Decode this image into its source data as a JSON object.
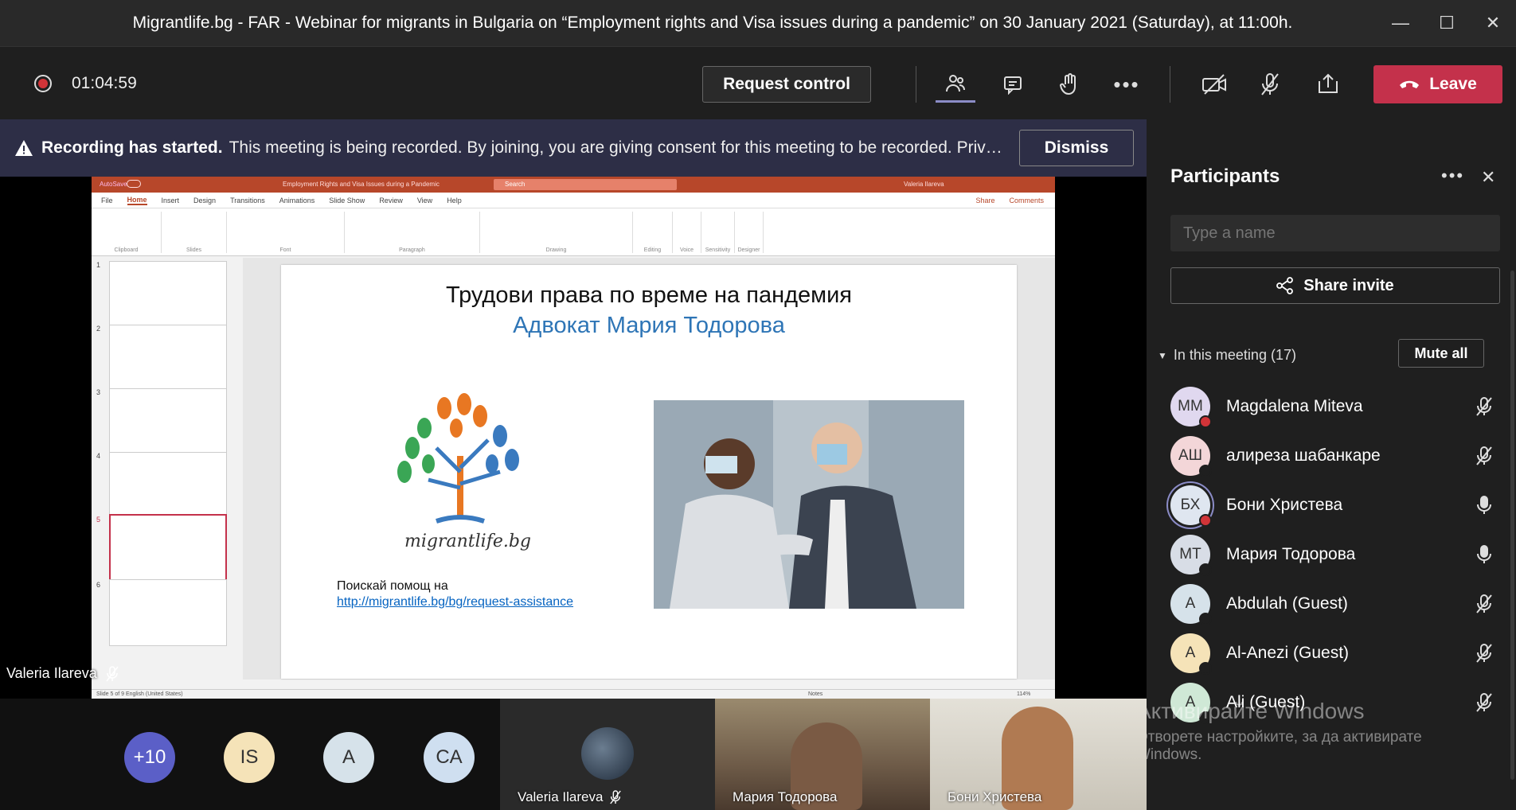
{
  "window": {
    "title": "Migrantlife.bg - FAR - Webinar for migrants in Bulgaria on “Employment rights and Visa issues during a pandemic” on 30 January 2021 (Saturday), at 11:00h."
  },
  "toolbar": {
    "timer": "01:04:59",
    "request_control": "Request control",
    "leave": "Leave",
    "accent": "#c4314b"
  },
  "banner": {
    "bold": "Recording has started.",
    "text": "This meeting is being recorded. By joining, you are giving consent for this meeting to be recorded. Priv…",
    "dismiss": "Dismiss"
  },
  "ppt": {
    "autosave": "AutoSave",
    "doc_title": "Employment Rights and Visa Issues during a Pandemic",
    "search": "Search",
    "user": "Valeria Ilareva",
    "tabs": [
      "File",
      "Home",
      "Insert",
      "Design",
      "Transitions",
      "Animations",
      "Slide Show",
      "Review",
      "View",
      "Help"
    ],
    "share": "Share",
    "comments": "Comments",
    "groups": [
      "Clipboard",
      "Slides",
      "Font",
      "Paragraph",
      "Drawing",
      "Editing",
      "Voice",
      "Sensitivity",
      "Designer"
    ],
    "thumb_numbers": [
      "1",
      "2",
      "3",
      "4",
      "5",
      "6"
    ],
    "status": "Slide 5 of 9     English (United States)",
    "notes": "Notes",
    "zoom": "114%"
  },
  "slide": {
    "title": "Трудови права по време на пандемия",
    "subtitle": "Адвокат Мария Тодорова",
    "logo": "migrantlife.bg",
    "help": "Поискай помощ на",
    "link": "http://migrantlife.bg/bg/request-assistance"
  },
  "presenter": {
    "name": "Valeria Ilareva"
  },
  "panel": {
    "title": "Participants",
    "search_placeholder": "Type a name",
    "share_invite": "Share invite",
    "in_meeting": "In this meeting (17)",
    "mute_all": "Mute all",
    "participants": [
      {
        "initials": "MM",
        "name": "Magdalena Miteva",
        "mic": "muted",
        "bg": "#e0d8ef",
        "dot": "#d13438"
      },
      {
        "initials": "АШ",
        "name": "алиреза шабанкаре",
        "mic": "muted",
        "bg": "#f3d6d8",
        "dot": "#1f1f1f"
      },
      {
        "initials": "БХ",
        "name": "Бони Христева",
        "mic": "on",
        "bg": "#dfe6f0",
        "dot": "#d13438"
      },
      {
        "initials": "МТ",
        "name": "Мария Тодорова",
        "mic": "on",
        "bg": "#d8dde6",
        "dot": "#1f1f1f"
      },
      {
        "initials": "A",
        "name": "Abdulah (Guest)",
        "mic": "muted",
        "bg": "#d6e2ea",
        "dot": "#1f1f1f"
      },
      {
        "initials": "A",
        "name": "Al-Anezi (Guest)",
        "mic": "muted",
        "bg": "#f5e3b8",
        "dot": "#1f1f1f"
      },
      {
        "initials": "A",
        "name": "Ali (Guest)",
        "mic": "muted",
        "bg": "#cfe8d6",
        "dot": "#1f1f1f"
      }
    ]
  },
  "watermark": {
    "line1": "Активирайте Windows",
    "line2": "Отворете настройките, за да активирате",
    "line3": "Windows."
  },
  "gallery": {
    "avatars": [
      {
        "label": "+10",
        "bg": "#5b5fc7",
        "fg": "#fff"
      },
      {
        "label": "IS",
        "bg": "#f5e3b8",
        "fg": "#333"
      },
      {
        "label": "A",
        "bg": "#d6e2ea",
        "fg": "#333"
      },
      {
        "label": "CA",
        "bg": "#cfdff0",
        "fg": "#333"
      }
    ],
    "tiles": [
      "Valeria Ilareva",
      "Мария Тодорова",
      "Бони Христева"
    ]
  }
}
